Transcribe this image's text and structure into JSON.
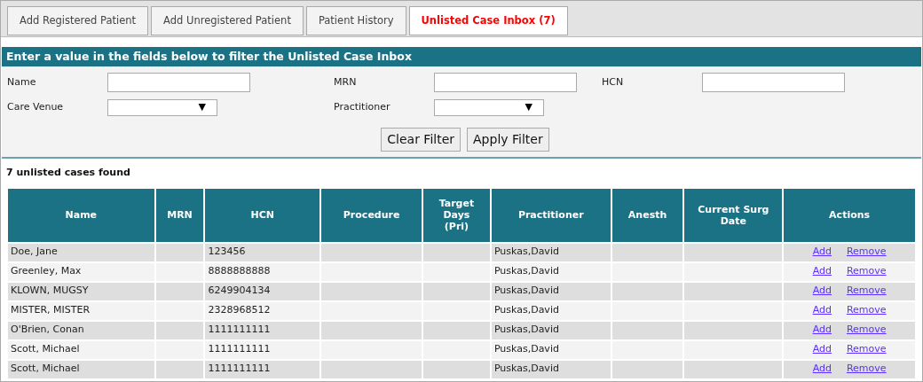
{
  "tabs": [
    {
      "label": "Add Registered Patient",
      "selected": false
    },
    {
      "label": "Add Unregistered Patient",
      "selected": false
    },
    {
      "label": "Patient History",
      "selected": false
    },
    {
      "label": "Unlisted Case Inbox (7)",
      "selected": true
    }
  ],
  "filter": {
    "title": "Enter a value in the fields below to filter the Unlisted Case Inbox",
    "fields": [
      {
        "label": "Name",
        "kind": "text"
      },
      {
        "label": "MRN",
        "kind": "text"
      },
      {
        "label": "HCN",
        "kind": "text"
      },
      {
        "label": "Care Venue",
        "kind": "select",
        "caret": "▼"
      },
      {
        "label": "Practitioner",
        "kind": "select",
        "caret": "▼"
      }
    ],
    "buttons": [
      "Clear Filter",
      "Apply Filter"
    ]
  },
  "result_count": "7 unlisted cases found",
  "table": {
    "columns": [
      "Name",
      "MRN",
      "HCN",
      "Procedure",
      "Target Days (Pri)",
      "Practitioner",
      "Anesth",
      "Current Surg Date",
      "Actions"
    ],
    "rows": [
      {
        "name": "Doe, Jane",
        "hcn": "123456",
        "practitioner": "Puskas,David",
        "actions": [
          "Add",
          "Remove"
        ]
      },
      {
        "name": "Greenley, Max",
        "hcn": "8888888888",
        "practitioner": "Puskas,David",
        "actions": [
          "Add",
          "Remove"
        ]
      },
      {
        "name": "KLOWN, MUGSY",
        "hcn": "6249904134",
        "practitioner": "Puskas,David",
        "actions": [
          "Add",
          "Remove"
        ]
      },
      {
        "name": "MISTER, MISTER",
        "hcn": "2328968512",
        "practitioner": "Puskas,David",
        "actions": [
          "Add",
          "Remove"
        ]
      },
      {
        "name": "O'Brien, Conan",
        "hcn": "1111111111",
        "practitioner": "Puskas,David",
        "actions": [
          "Add",
          "Remove"
        ]
      },
      {
        "name": "Scott, Michael",
        "hcn": "1111111111",
        "practitioner": "Puskas,David",
        "actions": [
          "Add",
          "Remove"
        ]
      },
      {
        "name": "Scott, Michael",
        "hcn": "1111111111",
        "practitioner": "Puskas,David",
        "actions": [
          "Add",
          "Remove"
        ]
      }
    ]
  }
}
